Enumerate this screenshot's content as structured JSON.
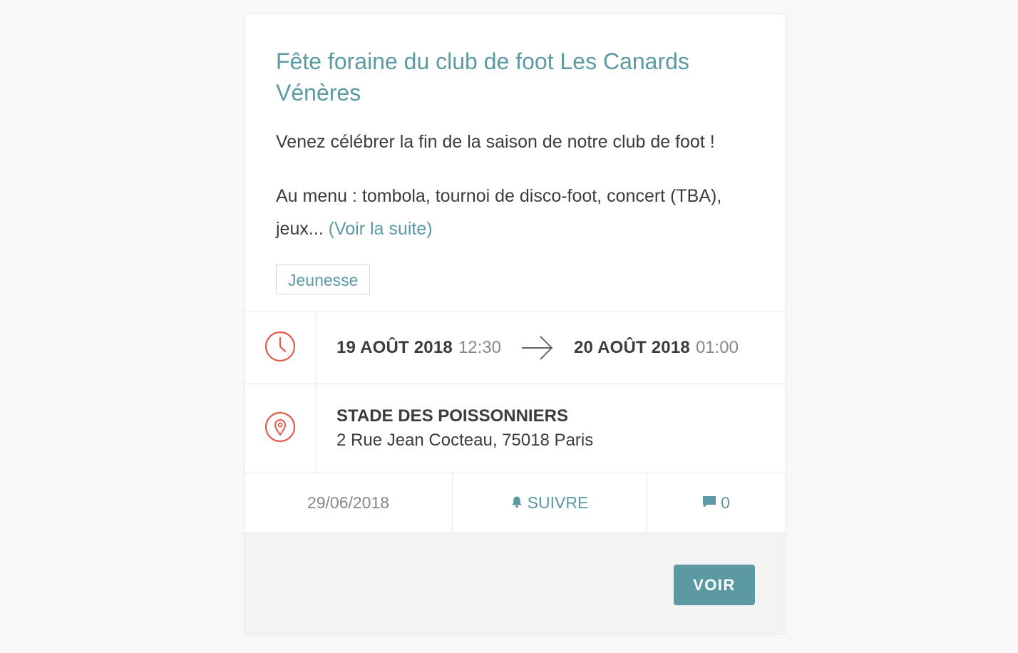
{
  "event": {
    "title": "Fête foraine du club de foot Les Canards Vénères",
    "description_line1": "Venez célébrer la fin de la saison de notre club de foot !",
    "description_line2": "Au menu : tombola, tournoi de disco-foot, concert (TBA), jeux...",
    "read_more": "(Voir la suite)",
    "tag": "Jeunesse"
  },
  "schedule": {
    "start_date": "19 AOÛT 2018",
    "start_time": "12:30",
    "end_date": "20 AOÛT 2018",
    "end_time": "01:00",
    "icon": "clock-icon",
    "arrow_icon": "arrow-right-icon"
  },
  "location": {
    "name": "STADE DES POISSONNIERS",
    "address": "2 Rue Jean Cocteau, 75018 Paris",
    "icon": "map-pin-icon"
  },
  "meta": {
    "published": "29/06/2018",
    "follow_label": "SUIVRE",
    "follow_icon": "bell-icon",
    "comment_count": "0",
    "comment_icon": "comment-icon"
  },
  "footer": {
    "button_label": "VOIR"
  },
  "colors": {
    "accent": "#5b9aa3",
    "icon_red": "#e05a47",
    "text": "#3c3c3c",
    "muted": "#888888"
  }
}
